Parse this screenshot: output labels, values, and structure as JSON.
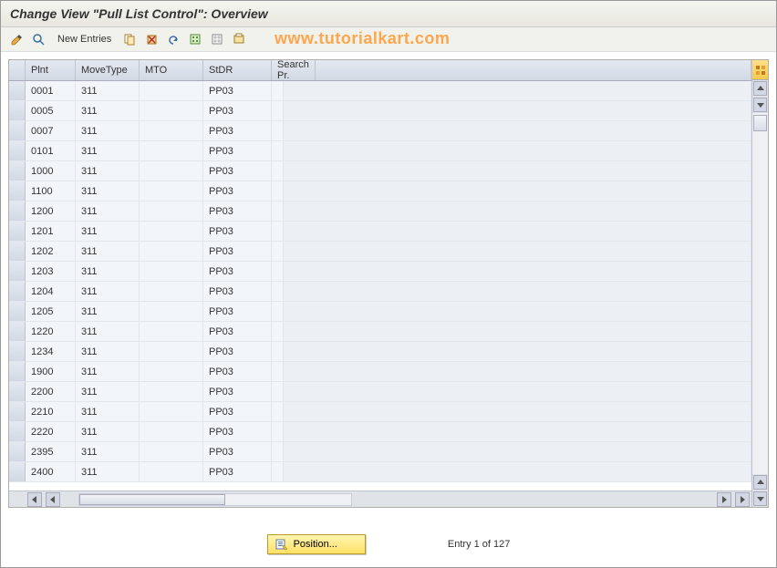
{
  "title": "Change View \"Pull List Control\": Overview",
  "toolbar": {
    "new_entries": "New Entries"
  },
  "watermark": "www.tutorialkart.com",
  "columns": {
    "plnt": "Plnt",
    "movetype": "MoveType",
    "mto": "MTO",
    "stdr": "StDR",
    "search": "Search Pr."
  },
  "rows": [
    {
      "plnt": "0001",
      "move": "311",
      "mto": "",
      "stdr": "PP03",
      "search": ""
    },
    {
      "plnt": "0005",
      "move": "311",
      "mto": "",
      "stdr": "PP03",
      "search": ""
    },
    {
      "plnt": "0007",
      "move": "311",
      "mto": "",
      "stdr": "PP03",
      "search": ""
    },
    {
      "plnt": "0101",
      "move": "311",
      "mto": "",
      "stdr": "PP03",
      "search": ""
    },
    {
      "plnt": "1000",
      "move": "311",
      "mto": "",
      "stdr": "PP03",
      "search": ""
    },
    {
      "plnt": "1100",
      "move": "311",
      "mto": "",
      "stdr": "PP03",
      "search": ""
    },
    {
      "plnt": "1200",
      "move": "311",
      "mto": "",
      "stdr": "PP03",
      "search": ""
    },
    {
      "plnt": "1201",
      "move": "311",
      "mto": "",
      "stdr": "PP03",
      "search": ""
    },
    {
      "plnt": "1202",
      "move": "311",
      "mto": "",
      "stdr": "PP03",
      "search": ""
    },
    {
      "plnt": "1203",
      "move": "311",
      "mto": "",
      "stdr": "PP03",
      "search": ""
    },
    {
      "plnt": "1204",
      "move": "311",
      "mto": "",
      "stdr": "PP03",
      "search": ""
    },
    {
      "plnt": "1205",
      "move": "311",
      "mto": "",
      "stdr": "PP03",
      "search": ""
    },
    {
      "plnt": "1220",
      "move": "311",
      "mto": "",
      "stdr": "PP03",
      "search": ""
    },
    {
      "plnt": "1234",
      "move": "311",
      "mto": "",
      "stdr": "PP03",
      "search": ""
    },
    {
      "plnt": "1900",
      "move": "311",
      "mto": "",
      "stdr": "PP03",
      "search": ""
    },
    {
      "plnt": "2200",
      "move": "311",
      "mto": "",
      "stdr": "PP03",
      "search": ""
    },
    {
      "plnt": "2210",
      "move": "311",
      "mto": "",
      "stdr": "PP03",
      "search": ""
    },
    {
      "plnt": "2220",
      "move": "311",
      "mto": "",
      "stdr": "PP03",
      "search": ""
    },
    {
      "plnt": "2395",
      "move": "311",
      "mto": "",
      "stdr": "PP03",
      "search": ""
    },
    {
      "plnt": "2400",
      "move": "311",
      "mto": "",
      "stdr": "PP03",
      "search": ""
    }
  ],
  "footer": {
    "position_label": "Position...",
    "status": "Entry 1 of 127"
  }
}
